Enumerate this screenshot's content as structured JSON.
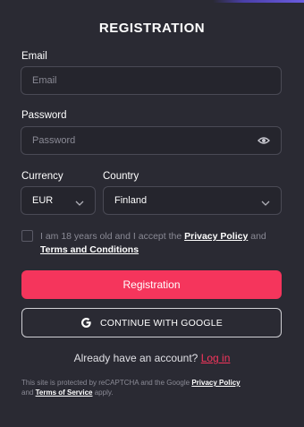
{
  "form": {
    "title": "REGISTRATION",
    "email": {
      "label": "Email",
      "placeholder": "Email"
    },
    "password": {
      "label": "Password",
      "placeholder": "Password"
    },
    "currency": {
      "label": "Currency",
      "value": "EUR"
    },
    "country": {
      "label": "Country",
      "value": "Finland"
    },
    "terms": {
      "text_before": "I am 18 years old and I accept the",
      "privacy_link": "Privacy Policy",
      "text_and": "and",
      "terms_link": "Terms and Conditions"
    },
    "register_button": "Registration",
    "google_button": "CONTINUE WITH GOOGLE",
    "account_prompt": "Already have an account?",
    "login_link": "Log in",
    "recaptcha": {
      "text_before": "This site is protected by reCAPTCHA and the Google",
      "privacy_link": "Privacy Policy",
      "text_and": "and",
      "tos_link": "Terms of Service",
      "text_after": "apply."
    }
  },
  "colors": {
    "background": "#2a2a33",
    "accent": "#f5355c",
    "field_border": "#4a4a55",
    "muted_text": "#8a8a95"
  },
  "icons": {
    "eye": "eye-icon",
    "chevron": "chevron-down-icon",
    "google": "google-icon"
  }
}
